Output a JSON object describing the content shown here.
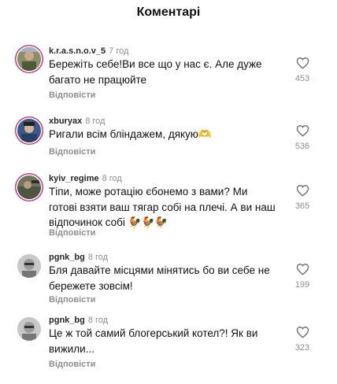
{
  "header": {
    "title": "Коментарі"
  },
  "comments": [
    {
      "username": "k.r.a.s.n.o.v_5",
      "time": "7 год",
      "text": "Бережіть себе!Ви все що у нас є. Але дуже багато не працюйте",
      "reply": "Відповісти",
      "likes": "453"
    },
    {
      "username": "xburyax",
      "time": "8 год",
      "text": "Ригали всім бліндажем, дякую🫶",
      "reply": "Відповісти",
      "likes": "536"
    },
    {
      "username": "kyiv_regime",
      "time": "8 год",
      "text": "Тіпи, може ротацію єбонемо з вами? Ми готові взяти ваш тягар собі на плечі. А ви наш відпочинок собі 🐓🐓🐓",
      "reply": "Відповісти",
      "likes": "365"
    },
    {
      "username": "pgnk_bg",
      "time": "8 год",
      "text": "Бля давайте місцями мінятись бо ви себе не бережете зовсім!",
      "reply": "Відповісти",
      "likes": "199"
    },
    {
      "username": "pgnk_bg",
      "time": "8 год",
      "text": "Це ж той самий блогерський котел?! Як ви вижили...",
      "reply": "Відповісти",
      "likes": "323"
    }
  ]
}
